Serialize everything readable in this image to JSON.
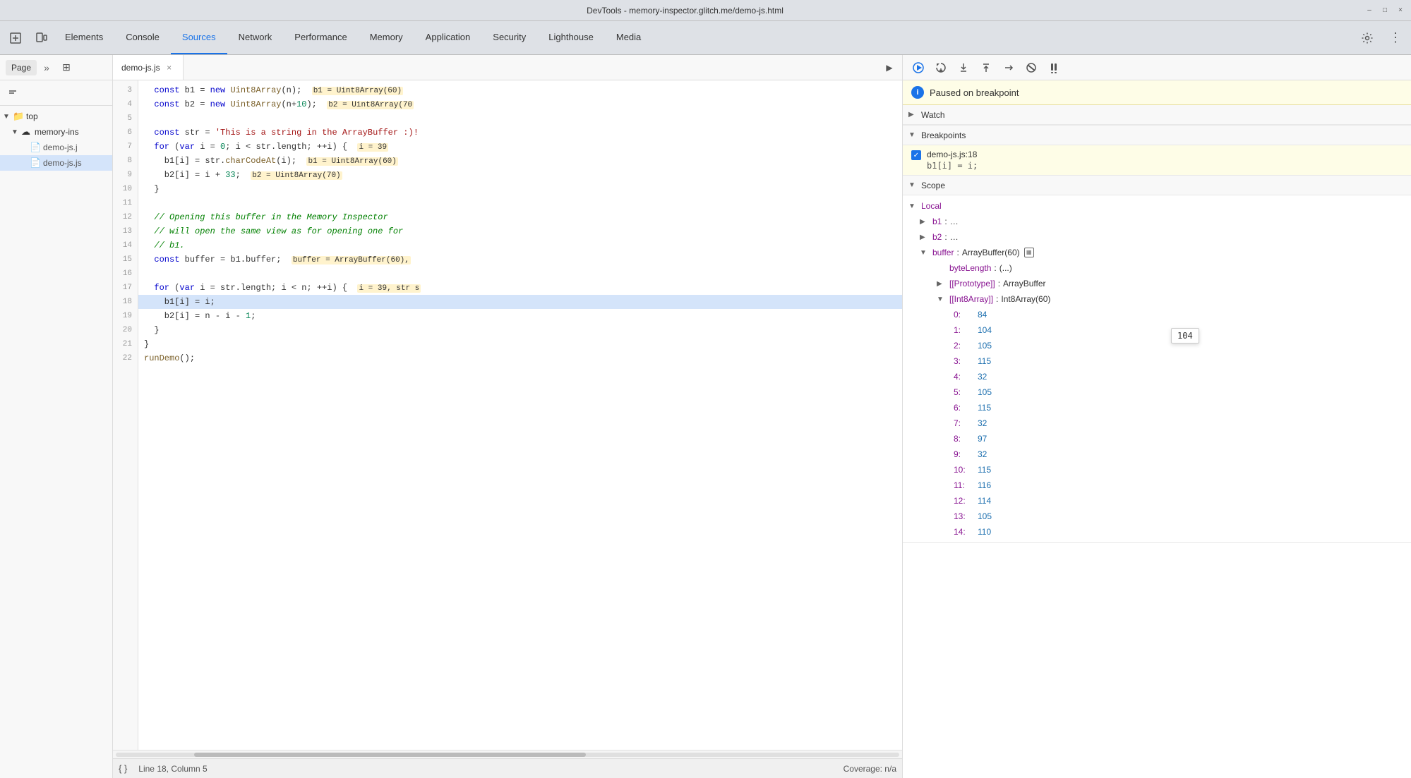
{
  "titlebar": {
    "title": "DevTools - memory-inspector.glitch.me/demo-js.html",
    "minimize": "–",
    "maximize": "□",
    "close": "×"
  },
  "tabs": {
    "items": [
      {
        "id": "elements",
        "label": "Elements"
      },
      {
        "id": "console",
        "label": "Console"
      },
      {
        "id": "sources",
        "label": "Sources"
      },
      {
        "id": "network",
        "label": "Network"
      },
      {
        "id": "performance",
        "label": "Performance"
      },
      {
        "id": "memory",
        "label": "Memory"
      },
      {
        "id": "application",
        "label": "Application"
      },
      {
        "id": "security",
        "label": "Security"
      },
      {
        "id": "lighthouse",
        "label": "Lighthouse"
      },
      {
        "id": "media",
        "label": "Media"
      }
    ]
  },
  "left_panel": {
    "tab_page": "Page",
    "file_tree": [
      {
        "type": "folder",
        "label": "top",
        "indent": 0,
        "expanded": true
      },
      {
        "type": "folder",
        "label": "memory-ins",
        "indent": 1,
        "expanded": true,
        "icon": "cloud"
      },
      {
        "type": "file",
        "label": "demo-js.j",
        "indent": 2,
        "icon": "file"
      },
      {
        "type": "file",
        "label": "demo-js.js",
        "indent": 2,
        "icon": "file"
      }
    ]
  },
  "code_editor": {
    "filename": "demo-js.js",
    "lines": [
      {
        "num": 3,
        "content": "  const b1 = new Uint8Array(n);  b1 = Uint8Array(60)"
      },
      {
        "num": 4,
        "content": "  const b2 = new Uint8Array(n+10);  b2 = Uint8Array(70"
      },
      {
        "num": 5,
        "content": ""
      },
      {
        "num": 6,
        "content": "  const str = 'This is a string in the ArrayBuffer :)!"
      },
      {
        "num": 7,
        "content": "  for (var i = 0; i < str.length; ++i) {  i = 39"
      },
      {
        "num": 8,
        "content": "    b1[i] = str.charCodeAt(i);  b1 = Uint8Array(60)"
      },
      {
        "num": 9,
        "content": "    b2[i] = i + 33;  b2 = Uint8Array(70)"
      },
      {
        "num": 10,
        "content": "  }"
      },
      {
        "num": 11,
        "content": ""
      },
      {
        "num": 12,
        "content": "  // Opening this buffer in the Memory Inspector"
      },
      {
        "num": 13,
        "content": "  // will open the same view as for opening one for"
      },
      {
        "num": 14,
        "content": "  // b1."
      },
      {
        "num": 15,
        "content": "  const buffer = b1.buffer;  buffer = ArrayBuffer(60),"
      },
      {
        "num": 16,
        "content": ""
      },
      {
        "num": 17,
        "content": "  for (var i = str.length; i < n; ++i) {  i = 39, str s"
      },
      {
        "num": 18,
        "content": "    b1[i] = i;",
        "highlighted": true
      },
      {
        "num": 19,
        "content": "    b2[i] = n - i - 1;"
      },
      {
        "num": 20,
        "content": "  }"
      },
      {
        "num": 21,
        "content": "}"
      },
      {
        "num": 22,
        "content": "runDemo();"
      }
    ],
    "status": {
      "line_col": "Line 18, Column 5",
      "coverage": "Coverage: n/a"
    }
  },
  "debugger": {
    "paused_message": "Paused on breakpoint",
    "toolbar_buttons": [
      {
        "id": "resume",
        "label": "▶",
        "title": "Resume script execution"
      },
      {
        "id": "step-over",
        "label": "↺",
        "title": "Step over"
      },
      {
        "id": "step-into",
        "label": "↓",
        "title": "Step into"
      },
      {
        "id": "step-out",
        "label": "↑",
        "title": "Step out"
      },
      {
        "id": "step",
        "label": "→",
        "title": "Step"
      },
      {
        "id": "deactivate",
        "label": "✖",
        "title": "Deactivate breakpoints"
      },
      {
        "id": "pause-exceptions",
        "label": "⏸",
        "title": "Pause on exceptions"
      }
    ],
    "sections": {
      "watch": {
        "label": "Watch",
        "expanded": true
      },
      "breakpoints": {
        "label": "Breakpoints",
        "expanded": true,
        "items": [
          {
            "checked": true,
            "file": "demo-js.js:18",
            "code": "b1[i] = i;"
          }
        ]
      },
      "scope": {
        "label": "Scope",
        "expanded": true,
        "local": {
          "label": "Local",
          "expanded": true,
          "items": [
            {
              "key": "b1",
              "value": "…",
              "expandable": true
            },
            {
              "key": "b2",
              "value": "…",
              "expandable": true
            },
            {
              "key": "buffer",
              "value": "ArrayBuffer(60)",
              "expandable": true,
              "expanded": true,
              "children": [
                {
                  "key": "byteLength",
                  "value": "(...)",
                  "indent": 1
                },
                {
                  "key": "[[Prototype]]",
                  "value": "ArrayBuffer",
                  "indent": 1,
                  "expandable": true
                },
                {
                  "key": "[[Int8Array]]",
                  "value": "Int8Array(60)",
                  "indent": 1,
                  "expandable": true,
                  "expanded": true,
                  "array_values": [
                    {
                      "index": "0",
                      "value": "84"
                    },
                    {
                      "index": "1",
                      "value": "104"
                    },
                    {
                      "index": "2",
                      "value": "105"
                    },
                    {
                      "index": "3",
                      "value": "115"
                    },
                    {
                      "index": "4",
                      "value": "32"
                    },
                    {
                      "index": "5",
                      "value": "105"
                    },
                    {
                      "index": "6",
                      "value": "115"
                    },
                    {
                      "index": "7",
                      "value": "32"
                    },
                    {
                      "index": "8",
                      "value": "97"
                    },
                    {
                      "index": "9",
                      "value": "32"
                    },
                    {
                      "index": "10",
                      "value": "115"
                    },
                    {
                      "index": "11",
                      "value": "116"
                    },
                    {
                      "index": "12",
                      "value": "114"
                    },
                    {
                      "index": "13",
                      "value": "105"
                    },
                    {
                      "index": "14",
                      "value": "110"
                    }
                  ]
                }
              ]
            }
          ]
        }
      }
    },
    "tooltip": {
      "value": "104",
      "visible": true
    }
  }
}
